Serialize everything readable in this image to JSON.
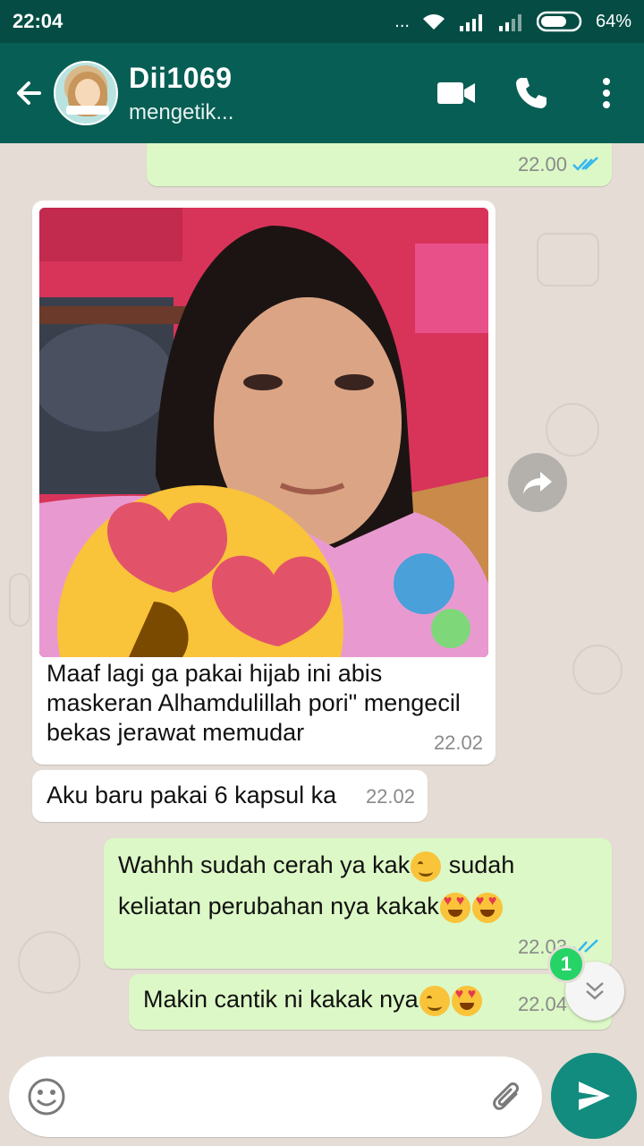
{
  "status_bar": {
    "time": "22:04",
    "dots": "...",
    "battery": "64%"
  },
  "header": {
    "contact_name": "Dii1069",
    "contact_status": "mengetik..."
  },
  "messages": [
    {
      "type": "outgoing",
      "text": "",
      "time": "22.00"
    },
    {
      "type": "incoming-photo",
      "caption_lines": [
        "Maaf lagi ga pakai hijab ini abis",
        "maskeran Alhamdulillah pori\" mengecil",
        "bekas jerawat memudar"
      ],
      "time": "22.02"
    },
    {
      "type": "incoming",
      "text": "Aku baru pakai 6 kapsul ka",
      "time": "22.02"
    },
    {
      "type": "outgoing",
      "line1": "Wahhh sudah cerah ya kak",
      "line1b": " sudah",
      "line2": "keliatan perubahan nya kakak",
      "time": "22.03"
    },
    {
      "type": "outgoing",
      "text": "Makin cantik ni kakak nya",
      "time": "22.04"
    }
  ],
  "scroll": {
    "unread_count": "1"
  },
  "composer": {
    "placeholder": ""
  },
  "colors": {
    "header": "#075e54",
    "outgoing": "#dcf8c6",
    "accent": "#128c7e",
    "tick_read": "#34b7f1"
  }
}
